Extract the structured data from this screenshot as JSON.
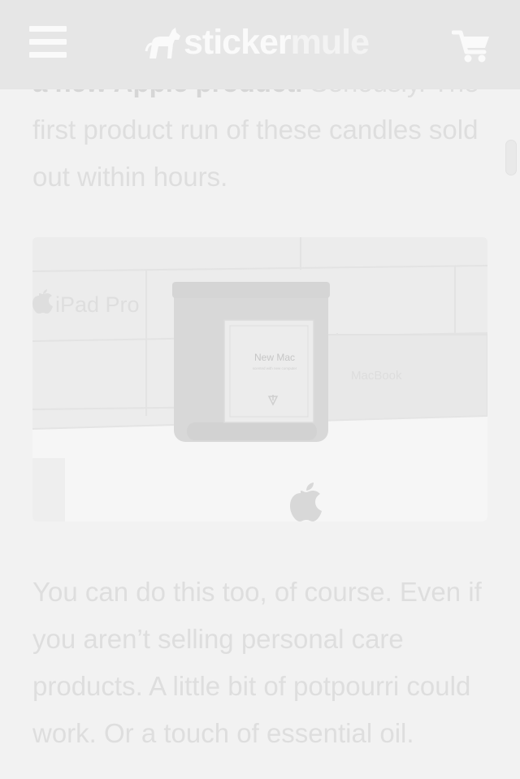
{
  "header": {
    "logo_part1": "sticker",
    "logo_part2": "mule",
    "menu_icon": "hamburger-menu-icon",
    "logo_icon": "mule-icon",
    "cart_icon": "shopping-cart-icon",
    "bg_color": "#e6e6e6",
    "icon_color": "#fafafa"
  },
  "article": {
    "intro_bold": "a new Apple product.",
    "intro_rest": " Seriously. The first product run of these candles sold out within hours.",
    "photo": {
      "box_label_left": "iPad Pro",
      "candle_label": "New Mac",
      "candle_sublabel": "scented with new computer",
      "box_label_right": "MacBook",
      "apple_logo_icon": "apple-logo-icon"
    },
    "second_paragraph": "You can do this too, of course. Even if you aren’t selling personal care products. A little bit of potpourri could work. Or a touch of essential oil."
  },
  "colors": {
    "page_bg": "#f2f2f2",
    "text": "#dedede"
  }
}
